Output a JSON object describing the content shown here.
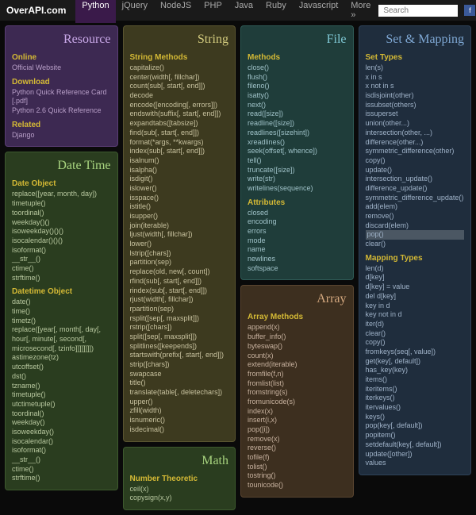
{
  "topbar": {
    "logo": "OverAPI.com",
    "nav": [
      "Python",
      "jQuery",
      "NodeJS",
      "PHP",
      "Java",
      "Ruby",
      "Javascript",
      "More »"
    ],
    "active_nav": 0,
    "search_placeholder": "Search"
  },
  "columns": [
    [
      {
        "color": "purple",
        "title": "Resource",
        "sections": [
          {
            "heading": "Online",
            "items": [
              "Official Website"
            ]
          },
          {
            "heading": "Download",
            "items": [
              "Python Quick Reference Card [.pdf]",
              "Python 2.6 Quick Reference"
            ]
          },
          {
            "heading": "Related",
            "items": [
              "Django"
            ]
          }
        ]
      },
      {
        "color": "green",
        "title": "Date Time",
        "sections": [
          {
            "heading": "Date Object",
            "items": [
              "replace([year, month, day])",
              "timetuple()",
              "toordinal()",
              "weekday()()",
              "isoweekday()()()",
              "isocalendar()()()",
              "isoformat()",
              "__str__()",
              "ctime()",
              "strftime()"
            ]
          },
          {
            "heading": "Datetime Object",
            "items": [
              "date()",
              "time()",
              "timetz()",
              "replace([year[, month[, day[, hour[, minute[, second[, microsecond[, tzinfo]]]]]]]])",
              "astimezone(tz)",
              "utcoffset()",
              "dst()",
              "tzname()",
              "timetuple()",
              "utctimetuple()",
              "toordinal()",
              "weekday()",
              "isoweekday()",
              "isocalendar()",
              "isoformat()",
              "__str__()",
              "ctime()",
              "strftime()"
            ]
          }
        ]
      }
    ],
    [
      {
        "color": "olive",
        "title": "String",
        "sections": [
          {
            "heading": "String Methods",
            "items": [
              "capitalize()",
              "center(width[, fillchar])",
              "count(sub[, start[, end]])",
              "decode",
              "encode([encoding[, errors]])",
              "endswith(suffix[, start[, end]])",
              "expandtabs([tabsize])",
              "find(sub[, start[, end]])",
              "format(*args, **kwargs)",
              "index(sub[, start[, end]])",
              "isalnum()",
              "isalpha()",
              "isdigit()",
              "islower()",
              "isspace()",
              "istitle()",
              "isupper()",
              "join(iterable)",
              "ljust(width[, fillchar])",
              "lower()",
              "lstrip([chars])",
              "partition(sep)",
              "replace(old, new[, count])",
              "rfind(sub[, start[, end]])",
              "rindex(sub[, start[, end]])",
              "rjust(width[, fillchar])",
              "rpartition(sep)",
              "rsplit([sep[, maxsplit]])",
              "rstrip([chars])",
              "split([sep[, maxsplit]])",
              "splitlines([keepends])",
              "startswith(prefix[, start[, end]])",
              "strip([chars])",
              "swapcase",
              "title()",
              "translate(table[, deletechars])",
              "upper()",
              "zfill(width)",
              "isnumeric()",
              "isdecimal()"
            ]
          }
        ]
      },
      {
        "color": "green",
        "title": "Math",
        "sections": [
          {
            "heading": "Number Theoretic",
            "items": [
              "ceil(x)",
              "copysign(x,y)"
            ]
          }
        ]
      }
    ],
    [
      {
        "color": "teal",
        "title": "File",
        "sections": [
          {
            "heading": "Methods",
            "items": [
              "close()",
              "flush()",
              "fileno()",
              "isatty()",
              "next()",
              "read([size])",
              "readline([size])",
              "readlines([sizehint])",
              "xreadlines()",
              "seek(offset[, whence])",
              "tell()",
              "truncate([size])",
              "write(str)",
              "writelines(sequence)"
            ]
          },
          {
            "heading": "Attributes",
            "items": [
              "closed",
              "encoding",
              "errors",
              "mode",
              "name",
              "newlines",
              "softspace"
            ]
          }
        ]
      },
      {
        "color": "brown",
        "title": "Array",
        "sections": [
          {
            "heading": "Array Methods",
            "items": [
              "append(x)",
              "buffer_info()",
              "byteswap()",
              "count(x)",
              "extend(iterable)",
              "fromfile(f,n)",
              "fromlist(list)",
              "fromstring(s)",
              "fromunicode(s)",
              "index(x)",
              "insert(i,x)",
              "pop([i])",
              "remove(x)",
              "reverse()",
              "tofile(f)",
              "tolist()",
              "tostring()",
              "tounicode()"
            ]
          }
        ]
      }
    ],
    [
      {
        "color": "blue",
        "title": "Set & Mapping",
        "sections": [
          {
            "heading": "Set Types",
            "items": [
              "len(s)",
              "x in s",
              "x not in s",
              "isdisjoint(other)",
              "issubset(others)",
              "issuperset",
              "union(other...)",
              "intersection(other, ...)",
              "difference(other...)",
              "symmetric_difference(other)",
              "copy()",
              "update()",
              "intersection_update()",
              "difference_update()",
              "symmetric_difference_update()",
              "add(elem)",
              "remove()",
              "discard(elem)",
              "pop()",
              "clear()"
            ],
            "highlight": 18
          },
          {
            "heading": "Mapping Types",
            "items": [
              "len(d)",
              "d[key]",
              "d[key] = value",
              "del d[key]",
              "key in d",
              "key not in d",
              "iter(d)",
              "clear()",
              "copy()",
              "fromkeys(seq[, value])",
              "get(key[, default])",
              "has_key(key)",
              "items()",
              "iteritems()",
              "iterkeys()",
              "itervalues()",
              "keys()",
              "pop(key[, default])",
              "popitem()",
              "setdefault(key[, default])",
              "update([other])",
              "values"
            ]
          }
        ]
      }
    ]
  ]
}
